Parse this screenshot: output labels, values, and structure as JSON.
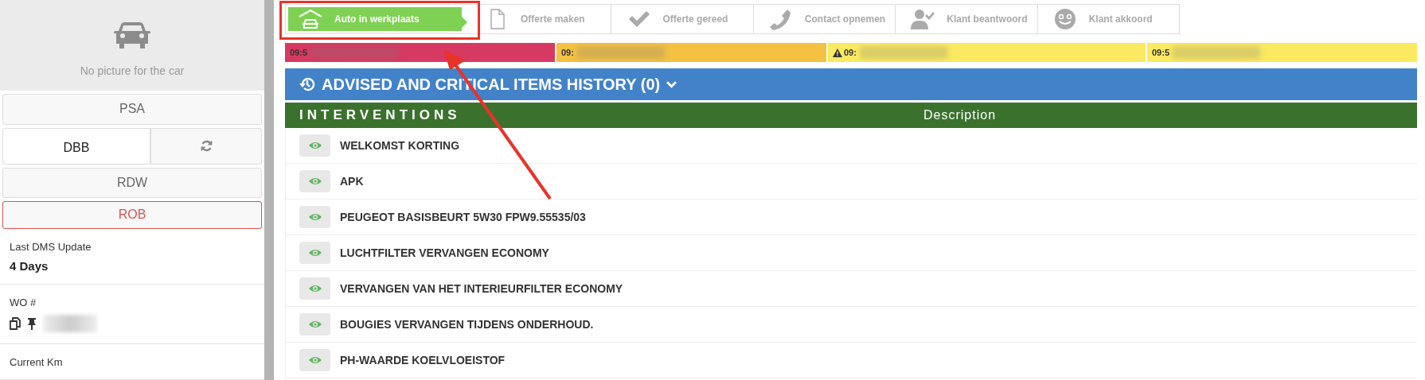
{
  "car_panel": {
    "no_picture": "No picture for the car",
    "sources": [
      {
        "label": "PSA",
        "kind": "plain"
      },
      {
        "label": "DBB",
        "kind": "split"
      },
      {
        "label": "RDW",
        "kind": "plain"
      },
      {
        "label": "ROB",
        "kind": "alert"
      }
    ],
    "fields": [
      {
        "label": "Last DMS Update",
        "value": "4 Days",
        "kind": "text"
      },
      {
        "label": "WO #",
        "kind": "redacted"
      },
      {
        "label": "Current Km",
        "kind": "text"
      }
    ]
  },
  "steps": [
    {
      "label": "Auto in werkplaats",
      "kind": "garage",
      "selected": true
    },
    {
      "label": "Offerte maken",
      "kind": "document",
      "selected": false
    },
    {
      "label": "Offerte gereed",
      "kind": "check",
      "selected": false
    },
    {
      "label": "Contact opnemen",
      "kind": "phone",
      "selected": false
    },
    {
      "label": "Klant beantwoord",
      "kind": "user-check",
      "selected": false
    },
    {
      "label": "Klant akkoord",
      "kind": "smiley",
      "selected": false
    }
  ],
  "timeline": [
    {
      "time": "09:5",
      "color": "#d63a63",
      "warning": false
    },
    {
      "time": "09:",
      "color": "#f5c142",
      "warning": false
    },
    {
      "time": "09:",
      "color": "#fbe962",
      "warning": true
    },
    {
      "time": "09:5",
      "color": "#fbe962",
      "warning": false
    }
  ],
  "history_bar": {
    "title": "ADVISED AND CRITICAL ITEMS HISTORY (0)"
  },
  "interventions": {
    "title": "INTERVENTIONS",
    "column": "Description",
    "rows": [
      "WELKOMST KORTING",
      "APK",
      "PEUGEOT BASISBEURT 5W30 FPW9.55535/03",
      "LUCHTFILTER VERVANGEN ECONOMY",
      "VERVANGEN VAN HET INTERIEURFILTER ECONOMY",
      "BOUGIES VERVANGEN TIJDENS ONDERHOUD.",
      "PH-WAARDE KOELVLOEISTOF"
    ]
  }
}
